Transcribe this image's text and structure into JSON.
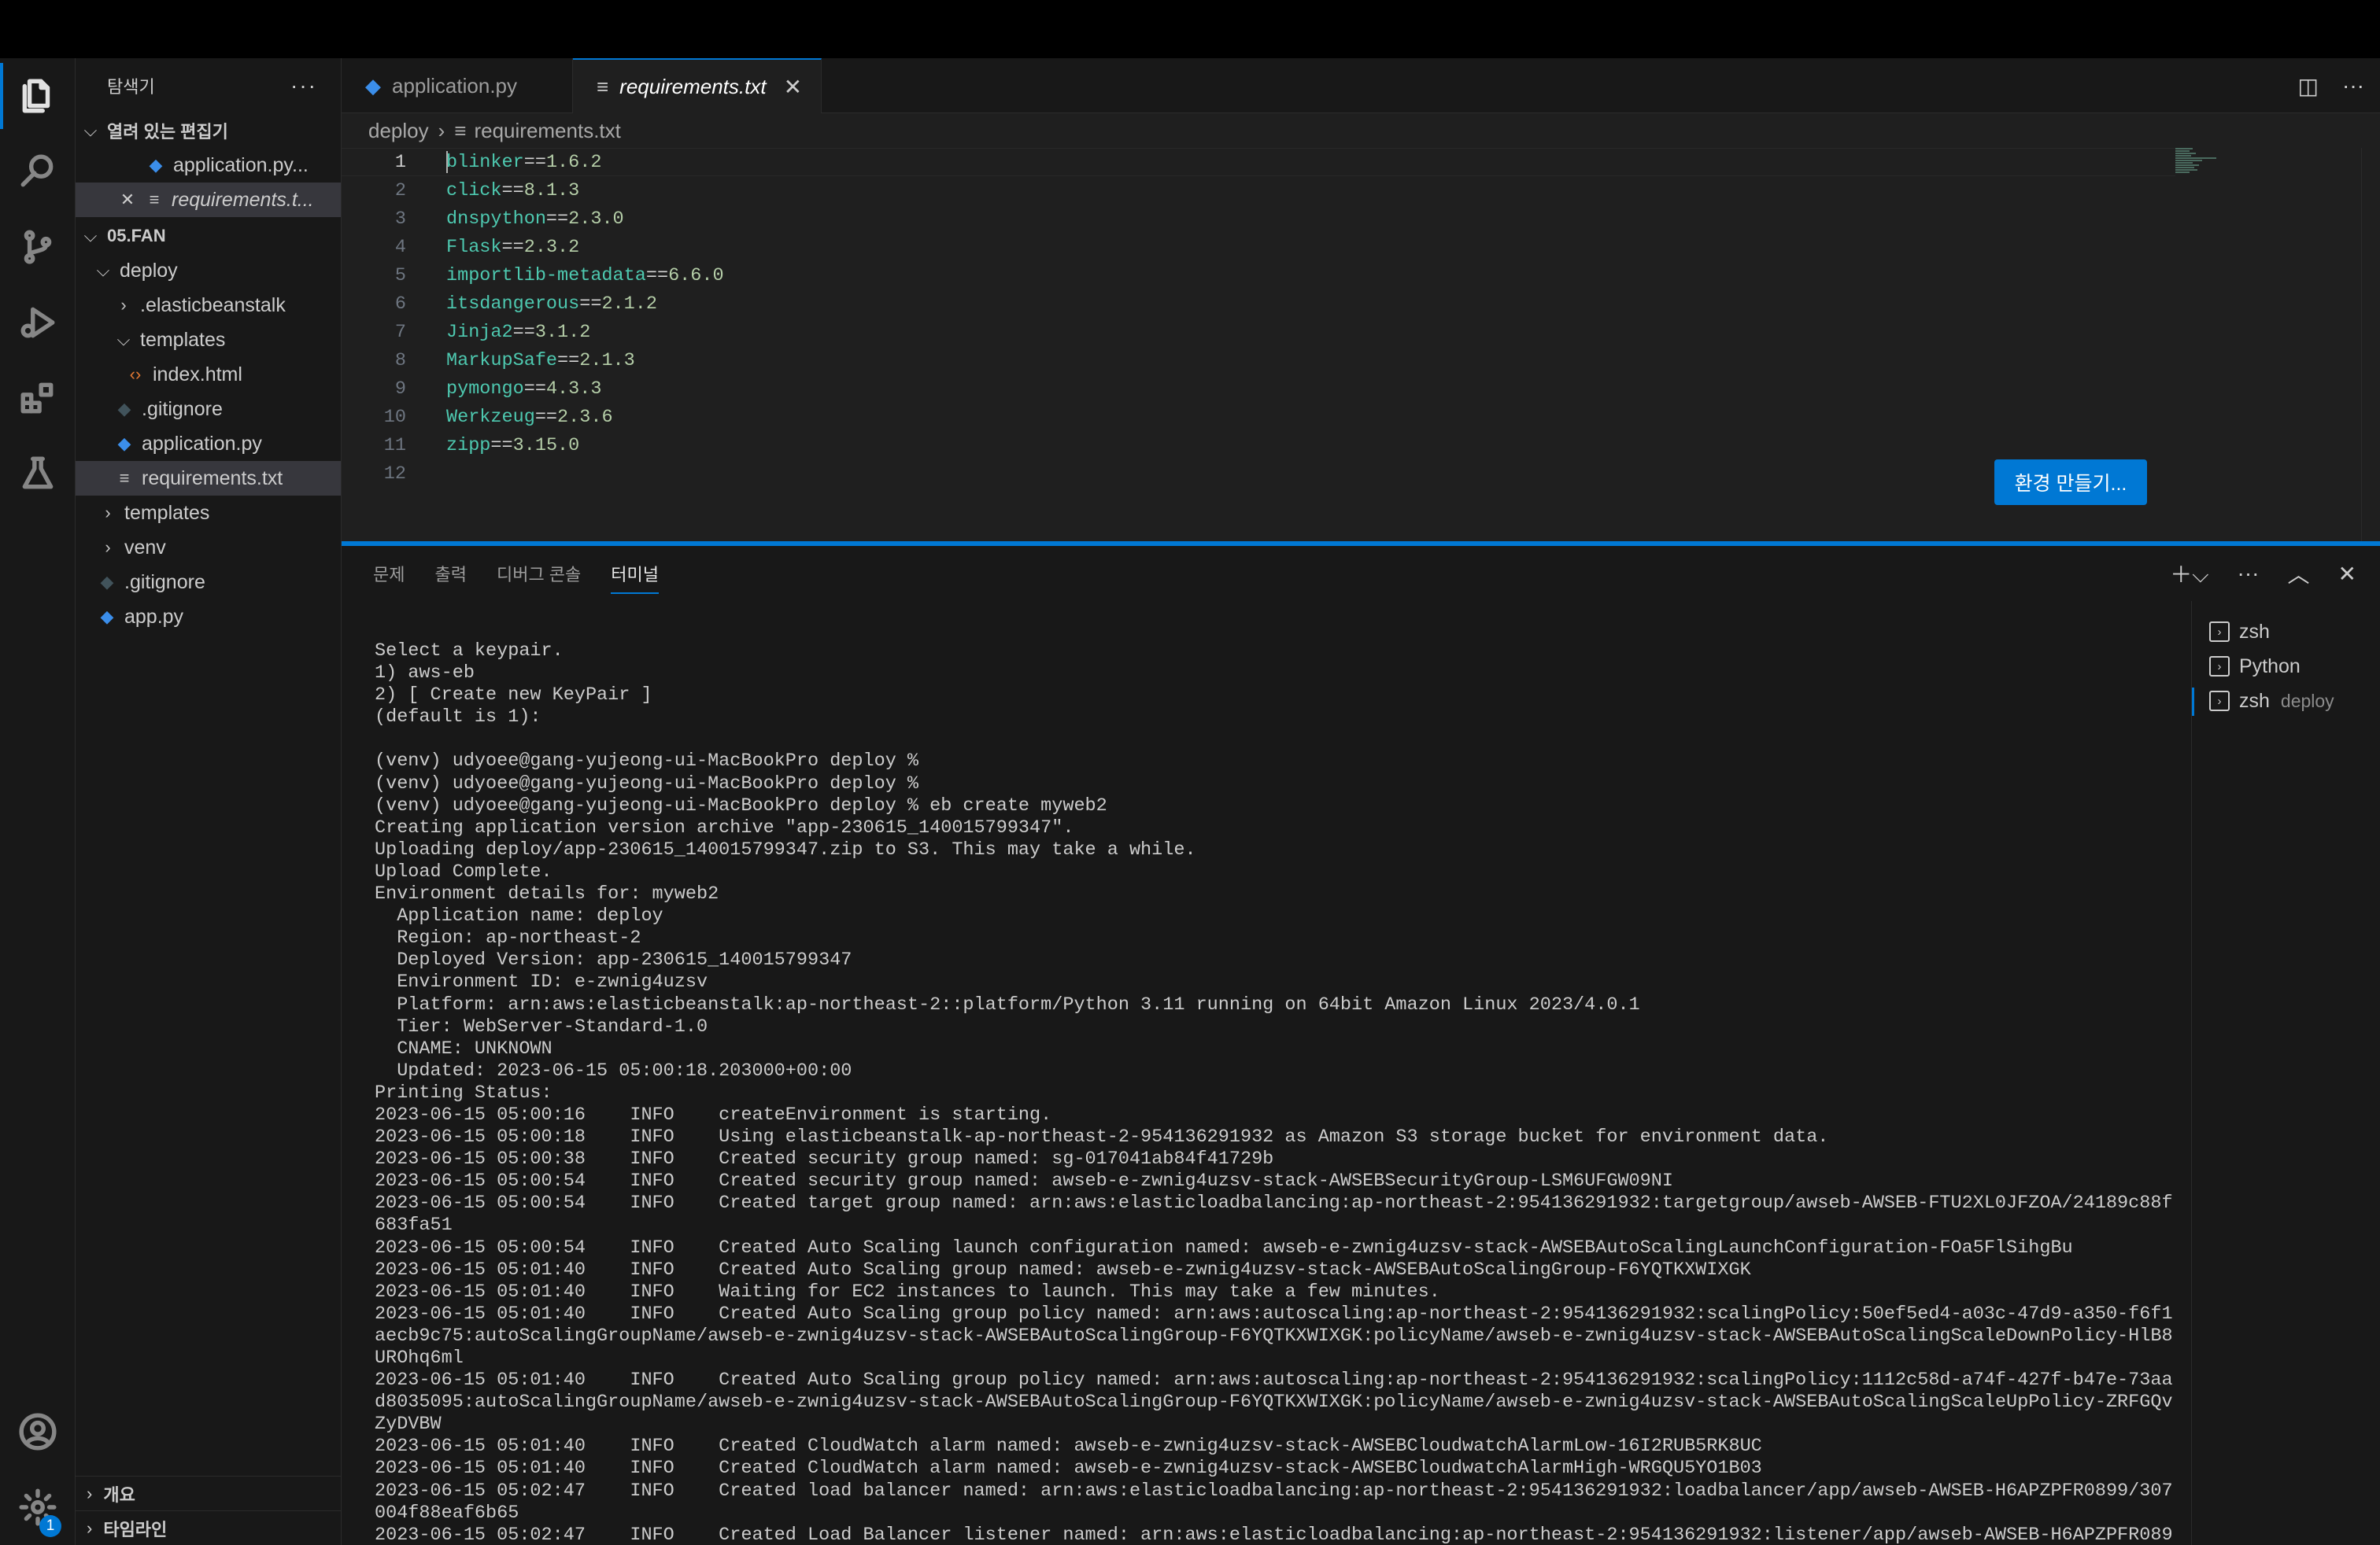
{
  "explorer": {
    "title": "탐색기",
    "more": "···",
    "open_editors": {
      "label": "열려 있는 편집기",
      "items": [
        {
          "name": "application.py..."
        },
        {
          "name": "requirements.t..."
        }
      ]
    },
    "root": {
      "label": "05.FAN",
      "items": [
        {
          "name": "deploy"
        },
        {
          "name": ".elasticbeanstalk"
        },
        {
          "name": "templates"
        },
        {
          "name": "index.html"
        },
        {
          "name": ".gitignore"
        },
        {
          "name": "application.py"
        },
        {
          "name": "requirements.txt"
        },
        {
          "name": "templates"
        },
        {
          "name": "venv"
        },
        {
          "name": ".gitignore"
        },
        {
          "name": "app.py"
        }
      ]
    },
    "outline_label": "개요",
    "timeline_label": "타임라인"
  },
  "activity": {
    "account_badge": "1"
  },
  "tabs": [
    {
      "label": "application.py"
    },
    {
      "label": "requirements.txt"
    }
  ],
  "breadcrumb": {
    "folder": "deploy",
    "file": "requirements.txt"
  },
  "editor": {
    "lines": [
      {
        "n": "1",
        "pkg": "blinker",
        "ver": "1.6.2"
      },
      {
        "n": "2",
        "pkg": "click",
        "ver": "8.1.3"
      },
      {
        "n": "3",
        "pkg": "dnspython",
        "ver": "2.3.0"
      },
      {
        "n": "4",
        "pkg": "Flask",
        "ver": "2.3.2"
      },
      {
        "n": "5",
        "pkg": "importlib-metadata",
        "ver": "6.6.0"
      },
      {
        "n": "6",
        "pkg": "itsdangerous",
        "ver": "2.1.2"
      },
      {
        "n": "7",
        "pkg": "Jinja2",
        "ver": "3.1.2"
      },
      {
        "n": "8",
        "pkg": "MarkupSafe",
        "ver": "2.1.3"
      },
      {
        "n": "9",
        "pkg": "pymongo",
        "ver": "4.3.3"
      },
      {
        "n": "10",
        "pkg": "Werkzeug",
        "ver": "2.3.6"
      },
      {
        "n": "11",
        "pkg": "zipp",
        "ver": "3.15.0"
      },
      {
        "n": "12",
        "pkg": "",
        "ver": ""
      }
    ],
    "operator": "==",
    "create_env_button": "환경 만들기..."
  },
  "panel": {
    "tabs": [
      "문제",
      "출력",
      "디버그 콘솔",
      "터미널"
    ],
    "terminals": [
      {
        "name": "zsh",
        "sub": ""
      },
      {
        "name": "Python",
        "sub": ""
      },
      {
        "name": "zsh",
        "sub": "deploy"
      }
    ],
    "terminal_lines": [
      "Select a keypair.",
      "1) aws-eb",
      "2) [ Create new KeyPair ]",
      "(default is 1):",
      "",
      "(venv) udyoee@gang-yujeong-ui-MacBookPro deploy %",
      "(venv) udyoee@gang-yujeong-ui-MacBookPro deploy %",
      "(venv) udyoee@gang-yujeong-ui-MacBookPro deploy % eb create myweb2",
      "Creating application version archive \"app-230615_140015799347\".",
      "Uploading deploy/app-230615_140015799347.zip to S3. This may take a while.",
      "Upload Complete.",
      "Environment details for: myweb2",
      "  Application name: deploy",
      "  Region: ap-northeast-2",
      "  Deployed Version: app-230615_140015799347",
      "  Environment ID: e-zwnig4uzsv",
      "  Platform: arn:aws:elasticbeanstalk:ap-northeast-2::platform/Python 3.11 running on 64bit Amazon Linux 2023/4.0.1",
      "  Tier: WebServer-Standard-1.0",
      "  CNAME: UNKNOWN",
      "  Updated: 2023-06-15 05:00:18.203000+00:00",
      "Printing Status:",
      "2023-06-15 05:00:16    INFO    createEnvironment is starting.",
      "2023-06-15 05:00:18    INFO    Using elasticbeanstalk-ap-northeast-2-954136291932 as Amazon S3 storage bucket for environment data.",
      "2023-06-15 05:00:38    INFO    Created security group named: sg-017041ab84f41729b",
      "2023-06-15 05:00:54    INFO    Created security group named: awseb-e-zwnig4uzsv-stack-AWSEBSecurityGroup-LSM6UFGW09NI",
      "2023-06-15 05:00:54    INFO    Created target group named: arn:aws:elasticloadbalancing:ap-northeast-2:954136291932:targetgroup/awseb-AWSEB-FTU2XL0JFZOA/24189c88f",
      "683fa51",
      "2023-06-15 05:00:54    INFO    Created Auto Scaling launch configuration named: awseb-e-zwnig4uzsv-stack-AWSEBAutoScalingLaunchConfiguration-FOa5FlSihgBu",
      "2023-06-15 05:01:40    INFO    Created Auto Scaling group named: awseb-e-zwnig4uzsv-stack-AWSEBAutoScalingGroup-F6YQTKXWIXGK",
      "2023-06-15 05:01:40    INFO    Waiting for EC2 instances to launch. This may take a few minutes.",
      "2023-06-15 05:01:40    INFO    Created Auto Scaling group policy named: arn:aws:autoscaling:ap-northeast-2:954136291932:scalingPolicy:50ef5ed4-a03c-47d9-a350-f6f1",
      "aecb9c75:autoScalingGroupName/awseb-e-zwnig4uzsv-stack-AWSEBAutoScalingGroup-F6YQTKXWIXGK:policyName/awseb-e-zwnig4uzsv-stack-AWSEBAutoScalingScaleDownPolicy-HlB8",
      "UROhq6ml",
      "2023-06-15 05:01:40    INFO    Created Auto Scaling group policy named: arn:aws:autoscaling:ap-northeast-2:954136291932:scalingPolicy:1112c58d-a74f-427f-b47e-73aa",
      "d8035095:autoScalingGroupName/awseb-e-zwnig4uzsv-stack-AWSEBAutoScalingGroup-F6YQTKXWIXGK:policyName/awseb-e-zwnig4uzsv-stack-AWSEBAutoScalingScaleUpPolicy-ZRFGQv",
      "ZyDVBW",
      "2023-06-15 05:01:40    INFO    Created CloudWatch alarm named: awseb-e-zwnig4uzsv-stack-AWSEBCloudwatchAlarmLow-16I2RUB5RK8UC",
      "2023-06-15 05:01:40    INFO    Created CloudWatch alarm named: awseb-e-zwnig4uzsv-stack-AWSEBCloudwatchAlarmHigh-WRGQU5YO1B03",
      "2023-06-15 05:02:47    INFO    Created load balancer named: arn:aws:elasticloadbalancing:ap-northeast-2:954136291932:loadbalancer/app/awseb-AWSEB-H6APZPFR0899/307",
      "004f88eaf6b65",
      "2023-06-15 05:02:47    INFO    Created Load Balancer listener named: arn:aws:elasticloadbalancing:ap-northeast-2:954136291932:listener/app/awseb-AWSEB-H6APZPFR089"
    ]
  },
  "colors": {
    "accent": "#0078d4",
    "package": "#4ec9b0",
    "version": "#b5cea8"
  }
}
